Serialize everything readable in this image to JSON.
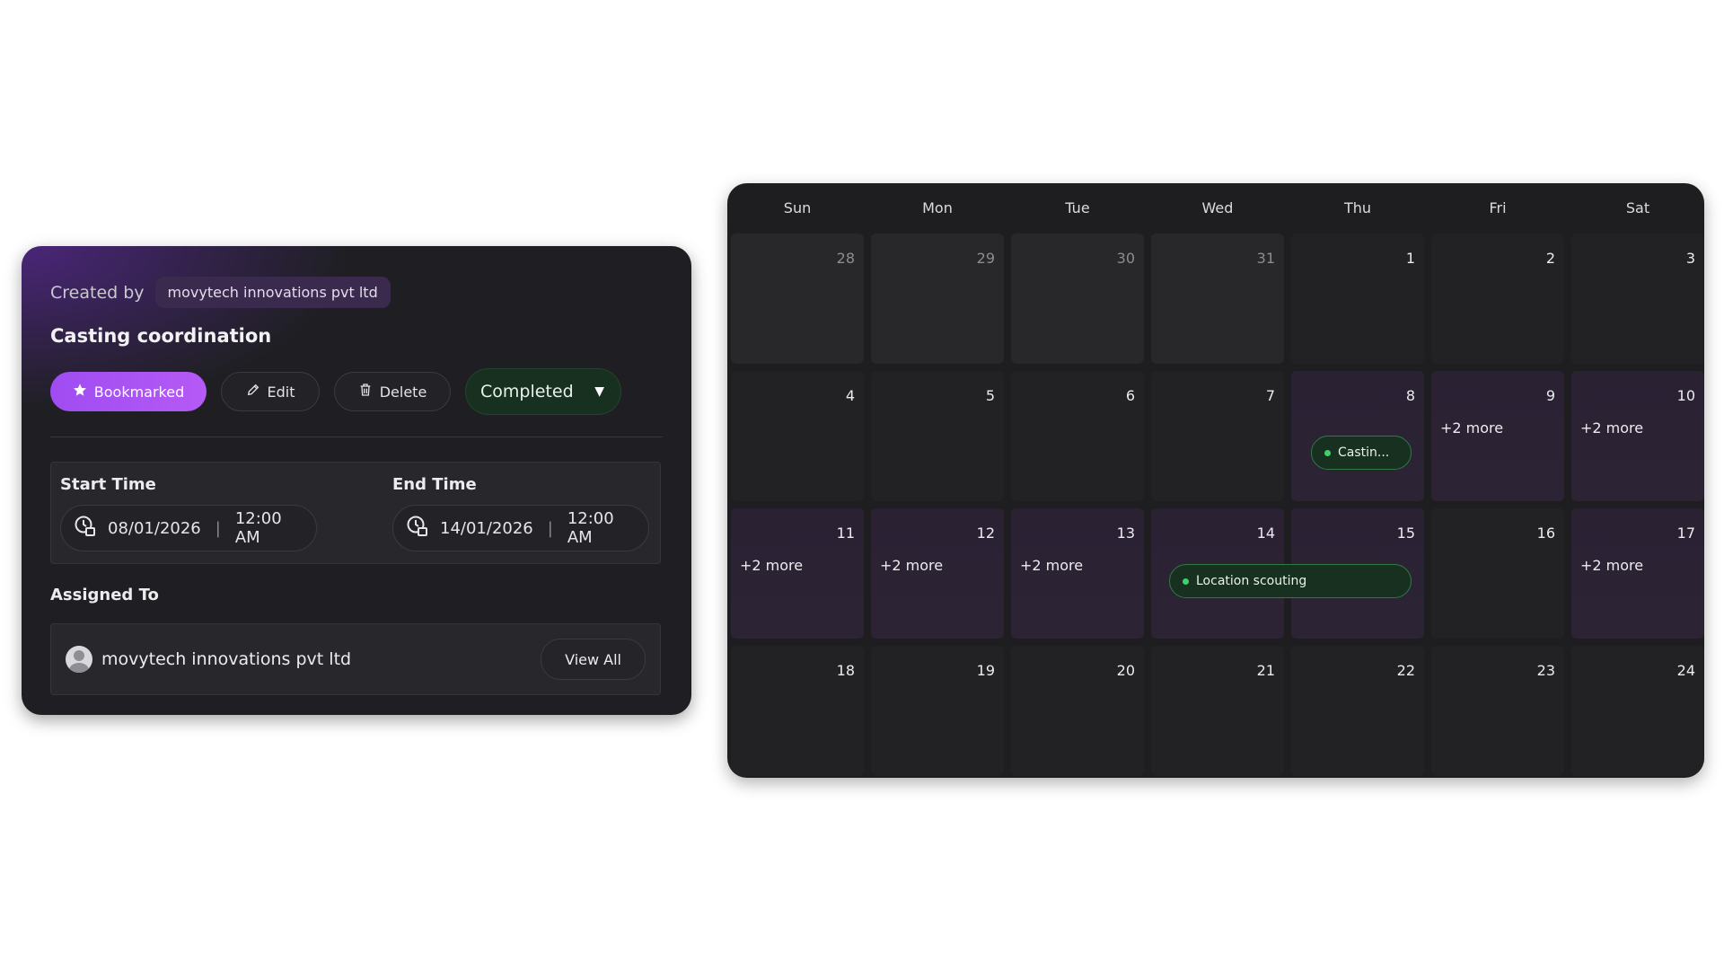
{
  "event": {
    "created_by_label": "Created by",
    "creator": "movytech innovations pvt ltd",
    "title": "Casting coordination",
    "bookmark_label": "Bookmarked",
    "edit_label": "Edit",
    "delete_label": "Delete",
    "status": "Completed",
    "start": {
      "label": "Start Time",
      "date": "08/01/2026",
      "time": "12:00 AM"
    },
    "end": {
      "label": "End Time",
      "date": "14/01/2026",
      "time": "12:00 AM"
    },
    "separator": "|",
    "assigned_label": "Assigned To",
    "assignee": "movytech innovations pvt ltd",
    "view_all_label": "View All"
  },
  "calendar": {
    "days_of_week": [
      "Sun",
      "Mon",
      "Tue",
      "Wed",
      "Thu",
      "Fri",
      "Sat"
    ],
    "weeks": [
      [
        "28",
        "29",
        "30",
        "31",
        "1",
        "2",
        "3"
      ],
      [
        "4",
        "5",
        "6",
        "7",
        "8",
        "9",
        "10"
      ],
      [
        "11",
        "12",
        "13",
        "14",
        "15",
        "16",
        "17"
      ],
      [
        "18",
        "19",
        "20",
        "21",
        "22",
        "23",
        "24"
      ]
    ],
    "more_label": "+2 more",
    "events": [
      {
        "title": "Castin...",
        "date": "8"
      },
      {
        "title": "Location scouting",
        "date": "14–15"
      }
    ],
    "colors": {
      "event_dot": "#3fd26b",
      "accent": "#a850f3"
    }
  }
}
